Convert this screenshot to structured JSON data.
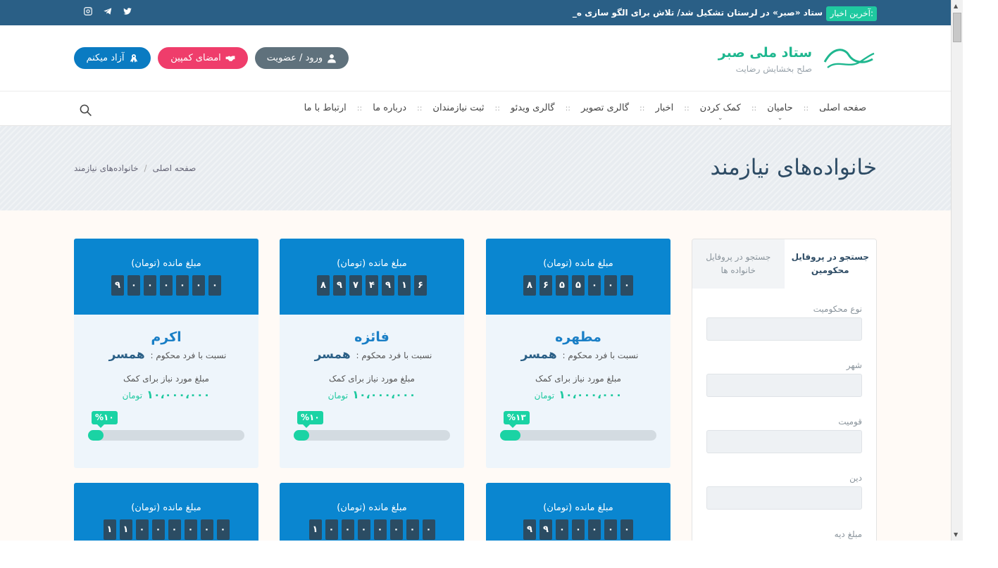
{
  "news": {
    "badge": "آخرین اخبار:",
    "headline": "ستاد «صبر» در لرستان تشکیل شد/ تلاش برای الگو سازی ه_"
  },
  "social": [
    "twitter-icon",
    "telegram-icon",
    "instagram-icon"
  ],
  "logo": {
    "title": "ستاد ملی صبر",
    "subtitle": "صلح  بخشایش  رضایت"
  },
  "header_buttons": {
    "login": "ورود / عضویت",
    "campaign": "امضای کمپین",
    "free": "آزاد میکنم"
  },
  "nav": [
    {
      "label": "صفحه اصلی",
      "dropdown": false
    },
    {
      "label": "حامیان",
      "dropdown": true
    },
    {
      "label": "کمک کردن",
      "dropdown": true
    },
    {
      "label": "اخبار",
      "dropdown": false
    },
    {
      "label": "گالری تصویر",
      "dropdown": false
    },
    {
      "label": "گالری ویدئو",
      "dropdown": false
    },
    {
      "label": "ثبت نیازمندان",
      "dropdown": false
    },
    {
      "label": "درباره ما",
      "dropdown": false
    },
    {
      "label": "ارتباط با ما",
      "dropdown": false
    }
  ],
  "nav_separator": "::",
  "page": {
    "title": "خانواده‌های نیازمند",
    "breadcrumb": [
      "صفحه اصلی",
      "خانواده‌های نیازمند"
    ],
    "breadcrumb_sep": "/"
  },
  "sidebar": {
    "tabs": [
      "جستجو در پروفایل محکومین",
      "جستجو در پروفایل خانواده ها"
    ],
    "fields": [
      "نوع محکومیت",
      "شهر",
      "قومیت",
      "دین",
      "مبلغ دیه"
    ]
  },
  "card_labels": {
    "remaining": "مبلغ مانده (تومان)",
    "relation_prefix": "نسبت با فرد محکوم",
    "need": "مبلغ مورد نیاز برای کمک",
    "unit": "تومان"
  },
  "cards": [
    {
      "remaining_digits": "۸۶۵۵۰۰۰",
      "name": "مطهره",
      "relation": "همسر",
      "amount": "۱۰،۰۰۰،۰۰۰",
      "percent_label": "%۱۳",
      "percent": 13
    },
    {
      "remaining_digits": "۸۹۷۴۹۱۶",
      "name": "فائزه",
      "relation": "همسر",
      "amount": "۱۰،۰۰۰،۰۰۰",
      "percent_label": "%۱۰",
      "percent": 10
    },
    {
      "remaining_digits": "۹۰۰۰۰۰۰",
      "name": "اکرم",
      "relation": "همسر",
      "amount": "۱۰،۰۰۰،۰۰۰",
      "percent_label": "%۱۰",
      "percent": 10
    },
    {
      "remaining_digits": "۹۹۰۰۰۰۰"
    },
    {
      "remaining_digits": "۱۰۰۰۰۰۰۰"
    },
    {
      "remaining_digits": "۱۱۰۰۰۰۰۰"
    }
  ],
  "colors": {
    "topbar": "#2a5f86",
    "accent_green": "#1fc9a0",
    "card_blue": "#0a86d0",
    "login_btn": "#5f717c",
    "campaign_btn": "#ef3d6b",
    "free_btn": "#0a7bc2"
  }
}
